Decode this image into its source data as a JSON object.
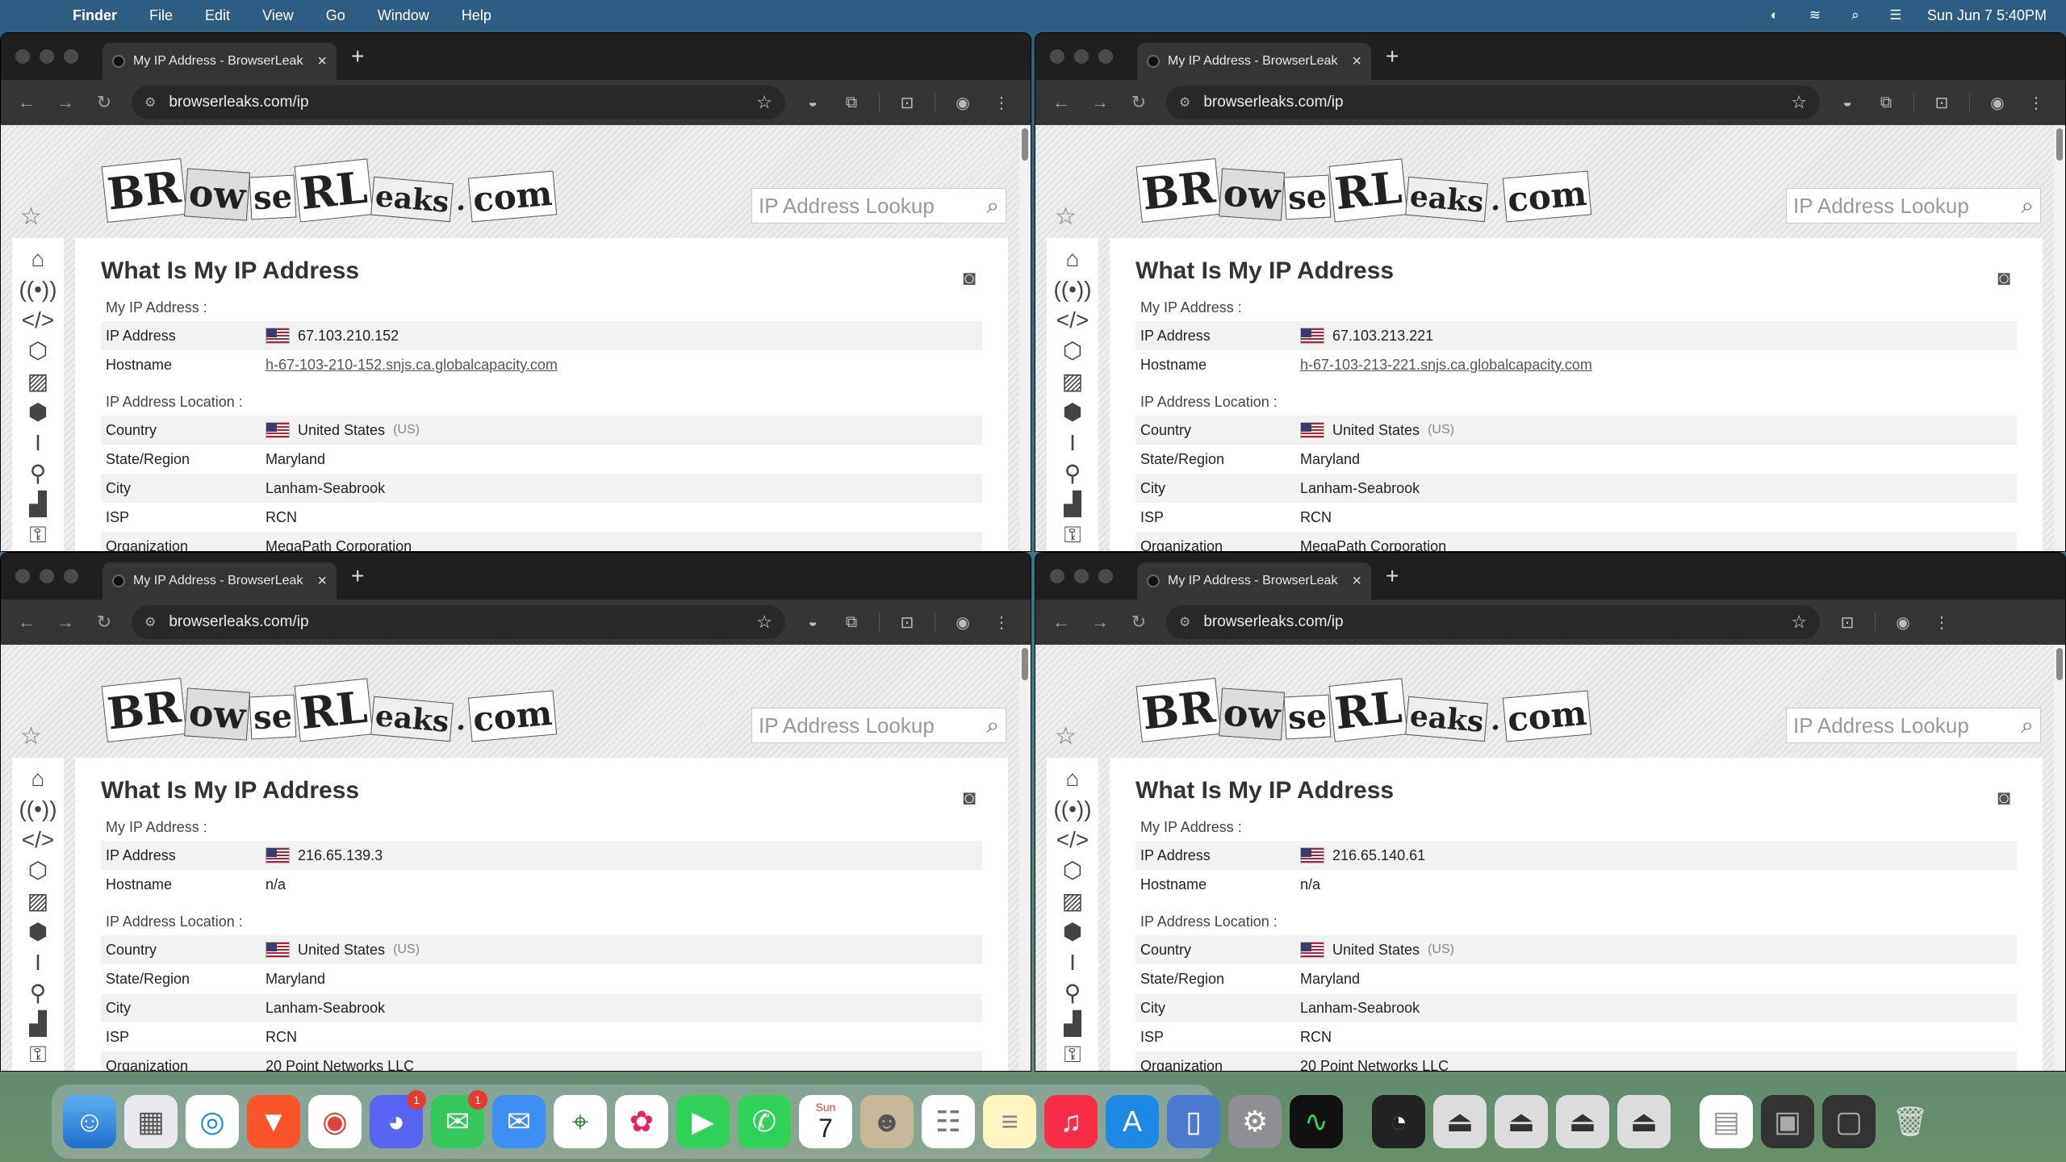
{
  "menubar": {
    "app": "Finder",
    "items": [
      "File",
      "Edit",
      "View",
      "Go",
      "Window",
      "Help"
    ],
    "clock": "Sun Jun 7  5:40PM"
  },
  "windows": [
    {
      "tab_title": "My IP Address - BrowserLeak",
      "url": "browserleaks.com/ip",
      "search_placeholder": "IP Address Lookup",
      "page_title": "What Is My IP Address",
      "sec_ip": "My IP Address :",
      "sec_loc": "IP Address Location :",
      "rows_ip": [
        {
          "k": "IP Address",
          "v": "67.103.210.152"
        },
        {
          "k": "Hostname",
          "v": "h-67-103-210-152.snjs.ca.globalcapacity.com"
        }
      ],
      "rows_loc": [
        {
          "k": "Country",
          "v": "United States",
          "cc": "(US)"
        },
        {
          "k": "State/Region",
          "v": "Maryland"
        },
        {
          "k": "City",
          "v": "Lanham-Seabrook"
        },
        {
          "k": "ISP",
          "v": "RCN"
        },
        {
          "k": "Organization",
          "v": "MegaPath Corporation"
        }
      ]
    },
    {
      "tab_title": "My IP Address - BrowserLeak",
      "url": "browserleaks.com/ip",
      "search_placeholder": "IP Address Lookup",
      "page_title": "What Is My IP Address",
      "sec_ip": "My IP Address :",
      "sec_loc": "IP Address Location :",
      "rows_ip": [
        {
          "k": "IP Address",
          "v": "67.103.213.221"
        },
        {
          "k": "Hostname",
          "v": "h-67-103-213-221.snjs.ca.globalcapacity.com"
        }
      ],
      "rows_loc": [
        {
          "k": "Country",
          "v": "United States",
          "cc": "(US)"
        },
        {
          "k": "State/Region",
          "v": "Maryland"
        },
        {
          "k": "City",
          "v": "Lanham-Seabrook"
        },
        {
          "k": "ISP",
          "v": "RCN"
        },
        {
          "k": "Organization",
          "v": "MegaPath Corporation"
        }
      ]
    },
    {
      "tab_title": "My IP Address - BrowserLeak",
      "url": "browserleaks.com/ip",
      "search_placeholder": "IP Address Lookup",
      "page_title": "What Is My IP Address",
      "sec_ip": "My IP Address :",
      "sec_loc": "IP Address Location :",
      "rows_ip": [
        {
          "k": "IP Address",
          "v": "216.65.139.3"
        },
        {
          "k": "Hostname",
          "v": "n/a"
        }
      ],
      "rows_loc": [
        {
          "k": "Country",
          "v": "United States",
          "cc": "(US)"
        },
        {
          "k": "State/Region",
          "v": "Maryland"
        },
        {
          "k": "City",
          "v": "Lanham-Seabrook"
        },
        {
          "k": "ISP",
          "v": "RCN"
        },
        {
          "k": "Organization",
          "v": "20 Point Networks LLC"
        }
      ]
    },
    {
      "tab_title": "My IP Address - BrowserLeak",
      "url": "browserleaks.com/ip",
      "search_placeholder": "IP Address Lookup",
      "page_title": "What Is My IP Address",
      "sec_ip": "My IP Address :",
      "sec_loc": "IP Address Location :",
      "rows_ip": [
        {
          "k": "IP Address",
          "v": "216.65.140.61"
        },
        {
          "k": "Hostname",
          "v": "n/a"
        }
      ],
      "rows_loc": [
        {
          "k": "Country",
          "v": "United States",
          "cc": "(US)"
        },
        {
          "k": "State/Region",
          "v": "Maryland"
        },
        {
          "k": "City",
          "v": "Lanham-Seabrook"
        },
        {
          "k": "ISP",
          "v": "RCN"
        },
        {
          "k": "Organization",
          "v": "20 Point Networks LLC"
        }
      ]
    }
  ],
  "logo_text": "BrowseRLeaks.com",
  "dock": {
    "calendar_month": "Sun",
    "calendar_day": "7",
    "discord_badge": "1",
    "messages_badge": "1"
  }
}
